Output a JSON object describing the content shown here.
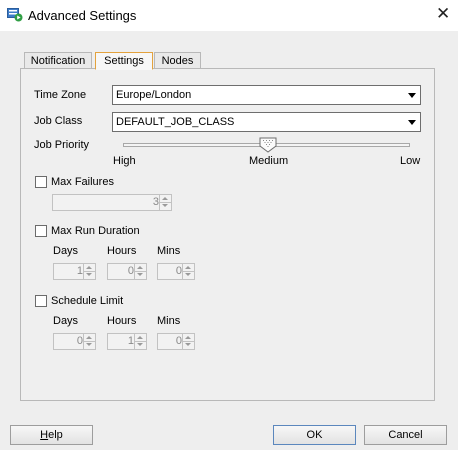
{
  "window": {
    "title": "Advanced Settings",
    "close_glyph": "✕",
    "icon": "settings-window-icon"
  },
  "tabs": [
    {
      "label": "Notification",
      "active": false
    },
    {
      "label": "Settings",
      "active": true
    },
    {
      "label": "Nodes",
      "active": false
    }
  ],
  "settings": {
    "time_zone": {
      "label": "Time Zone",
      "value": "Europe/London"
    },
    "job_class": {
      "label": "Job Class",
      "value": "DEFAULT_JOB_CLASS"
    },
    "job_priority": {
      "label": "Job Priority",
      "ticks": [
        "High",
        "Medium",
        "Low"
      ],
      "value": "Medium"
    },
    "max_failures": {
      "label": "Max Failures",
      "checked": false,
      "value": "3"
    },
    "max_run_duration": {
      "label": "Max Run Duration",
      "checked": false,
      "headers": {
        "days": "Days",
        "hours": "Hours",
        "mins": "Mins"
      },
      "days": "1",
      "hours": "0",
      "mins": "0"
    },
    "schedule_limit": {
      "label": "Schedule Limit",
      "checked": false,
      "headers": {
        "days": "Days",
        "hours": "Hours",
        "mins": "Mins"
      },
      "days": "0",
      "hours": "1",
      "mins": "0"
    }
  },
  "footer": {
    "help_label_first": "H",
    "help_label_rest": "elp",
    "ok_label": "OK",
    "cancel_label": "Cancel"
  },
  "colors": {
    "active_tab_border": "#e3a23d",
    "default_button_border": "#5b87bd"
  }
}
